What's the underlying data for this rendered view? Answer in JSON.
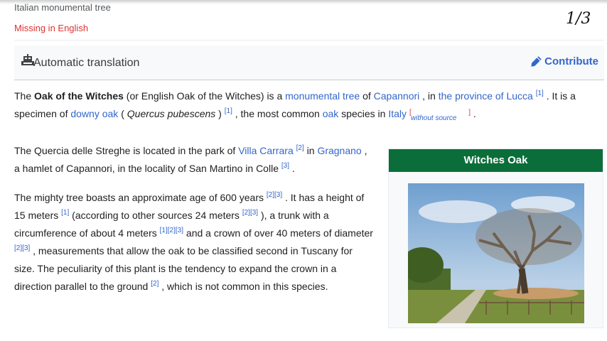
{
  "header": {
    "subtitle": "Italian monumental tree",
    "missing": "Missing in English",
    "page_counter": "1/3"
  },
  "translation_bar": {
    "label": "Automatic translation",
    "contribute": "Contribute"
  },
  "article": {
    "p1": {
      "t1": "The ",
      "bold": "Oak of the Witches",
      "t2": " (or English Oak of the Witches) is a ",
      "l1": "monumental tree",
      "t3": " of ",
      "l2": "Capannori",
      "t4": " , in ",
      "l3": "the province of Lucca",
      "r1": "[1]",
      "t5": " . It is a specimen of ",
      "l4": "downy oak",
      "t6": " ( ",
      "italic": "Quercus pubescens",
      "t7": " ) ",
      "r2": "[1]",
      "t8": " , the most common ",
      "l5": "oak",
      "t9": " species in ",
      "l6": "Italy",
      "wosrc_open": "[",
      "wosrc": "without source",
      "wosrc_close": "]",
      "t10": " ."
    },
    "p2": {
      "t1": "The Quercia delle Streghe is located in the park of ",
      "l1": "Villa Carrara",
      "r1": "[2]",
      "t2": " in ",
      "l2": "Gragnano",
      "t3": " , a hamlet of Capannori, in the locality of San Martino in Colle ",
      "r2": "[3]",
      "t4": " ."
    },
    "p3": {
      "t1": "The mighty tree boasts an approximate age of 600 years ",
      "r1": "[2]",
      "r2": "[3]",
      "t2": " . It has a height of 15 meters ",
      "r3": "[1]",
      "t3": " (according to other sources 24 meters ",
      "r4": "[2]",
      "r5": "[3]",
      "t4": " ), a trunk with a circumference of about 4 meters ",
      "r6": "[1]",
      "r7": "[2]",
      "r8": "[3]",
      "t5": " and a crown of over 40 meters of diameter ",
      "r9": "[2]",
      "r10": "[3]",
      "t6": " , measurements that allow the oak to be classified second in Tuscany for size. The peculiarity of this plant is the tendency to expand the crown in a direction parallel to the ground ",
      "r11": "[2]",
      "t7": " , which is not common in this species."
    }
  },
  "infobox": {
    "title": "Witches Oak",
    "header_color": "#0b6e3a"
  },
  "colors": {
    "link": "#3366cc",
    "redlink": "#dd3333",
    "text": "#202122"
  }
}
